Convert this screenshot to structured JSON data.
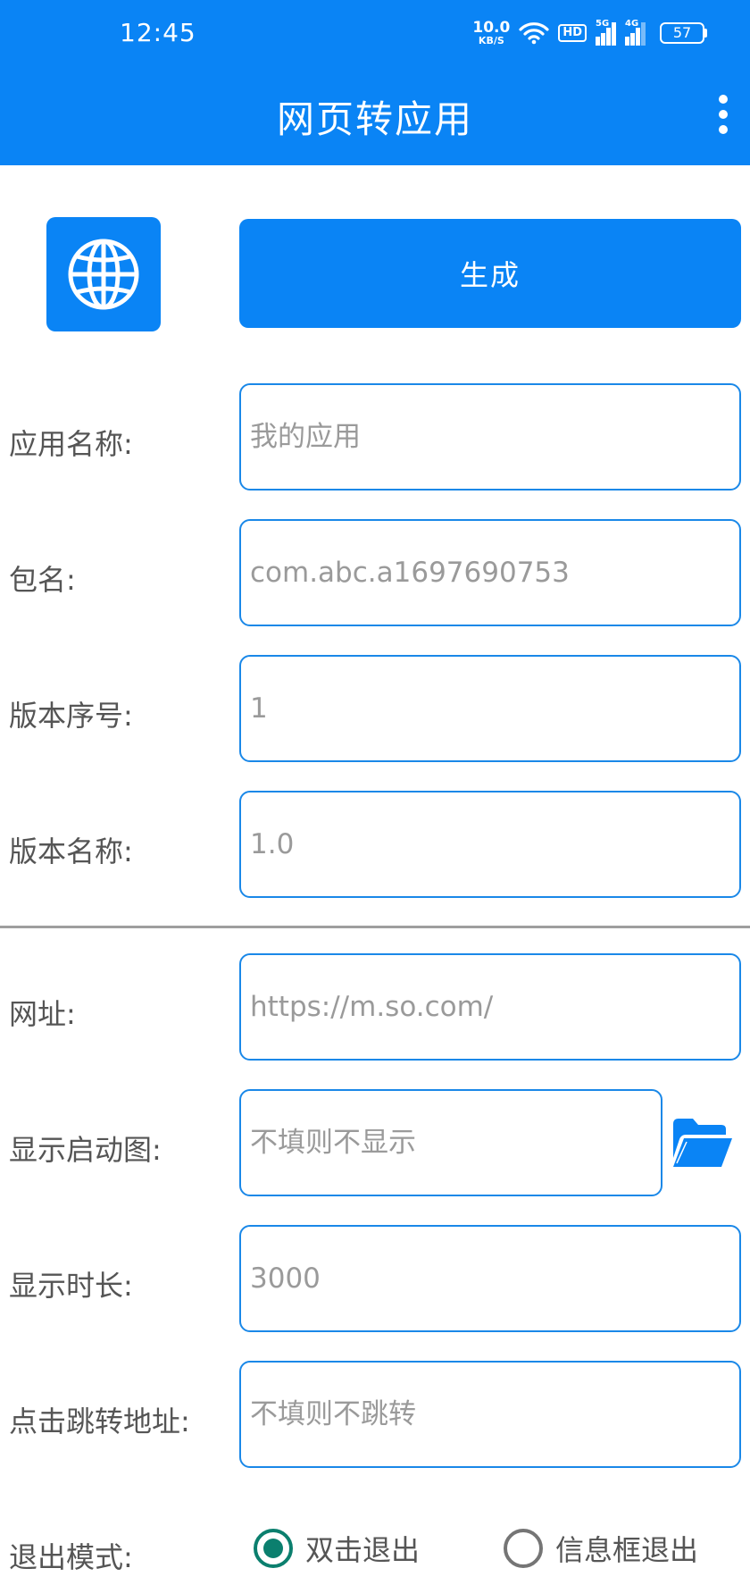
{
  "status_bar": {
    "time": "12:45",
    "net_speed_value": "10.0",
    "net_speed_unit": "KB/S",
    "hd_label": "HD",
    "signal1_label": "5G",
    "signal2_label": "4G",
    "battery": "57"
  },
  "app_bar": {
    "title": "网页转应用"
  },
  "actions": {
    "generate_label": "生成"
  },
  "form": {
    "app_name": {
      "label": "应用名称:",
      "placeholder": "我的应用"
    },
    "package": {
      "label": "包名:",
      "placeholder": "com.abc.a1697690753"
    },
    "version_code": {
      "label": "版本序号:",
      "placeholder": "1"
    },
    "version_name": {
      "label": "版本名称:",
      "placeholder": "1.0"
    },
    "url": {
      "label": "网址:",
      "placeholder": "https://m.so.com/"
    },
    "splash": {
      "label": "显示启动图:",
      "placeholder": "不填则不显示"
    },
    "duration": {
      "label": "显示时长:",
      "placeholder": "3000"
    },
    "click_url": {
      "label": "点击跳转地址:",
      "placeholder": "不填则不跳转"
    },
    "exit_mode": {
      "label": "退出模式:",
      "options": [
        "双击退出",
        "信息框退出"
      ],
      "selected": "双击退出"
    }
  },
  "icons": {
    "app_icon": "globe-icon",
    "splash_picker": "folder-open-icon",
    "menu": "more-vert-icon"
  },
  "colors": {
    "primary": "#0a84f5",
    "field_border": "#1a88e8",
    "radio_checked": "#0b7f6e",
    "divider": "#9e9e9e"
  }
}
